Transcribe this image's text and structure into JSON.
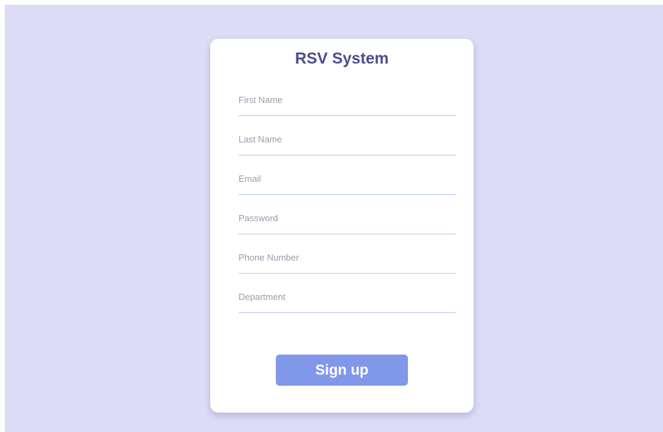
{
  "form": {
    "title": "RSV System",
    "fields": [
      {
        "placeholder": "First Name",
        "value": ""
      },
      {
        "placeholder": "Last Name",
        "value": ""
      },
      {
        "placeholder": "Email",
        "value": ""
      },
      {
        "placeholder": "Password",
        "value": ""
      },
      {
        "placeholder": "Phone Number",
        "value": ""
      },
      {
        "placeholder": "Department",
        "value": ""
      }
    ],
    "submit_label": "Sign up"
  },
  "colors": {
    "background": "#dcdcf6",
    "card": "#ffffff",
    "title": "#4a4e8c",
    "underline": "#b9c5f1",
    "button": "#8097ea"
  }
}
